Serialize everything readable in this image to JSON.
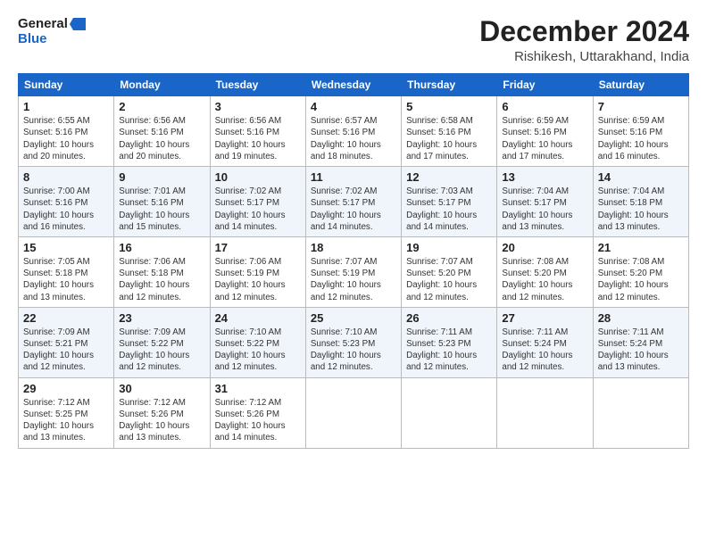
{
  "logo": {
    "line1": "General",
    "line2": "Blue"
  },
  "header": {
    "month": "December 2024",
    "location": "Rishikesh, Uttarakhand, India"
  },
  "weekdays": [
    "Sunday",
    "Monday",
    "Tuesday",
    "Wednesday",
    "Thursday",
    "Friday",
    "Saturday"
  ],
  "weeks": [
    [
      {
        "day": "1",
        "sunrise": "Sunrise: 6:55 AM",
        "sunset": "Sunset: 5:16 PM",
        "daylight": "Daylight: 10 hours and 20 minutes."
      },
      {
        "day": "2",
        "sunrise": "Sunrise: 6:56 AM",
        "sunset": "Sunset: 5:16 PM",
        "daylight": "Daylight: 10 hours and 20 minutes."
      },
      {
        "day": "3",
        "sunrise": "Sunrise: 6:56 AM",
        "sunset": "Sunset: 5:16 PM",
        "daylight": "Daylight: 10 hours and 19 minutes."
      },
      {
        "day": "4",
        "sunrise": "Sunrise: 6:57 AM",
        "sunset": "Sunset: 5:16 PM",
        "daylight": "Daylight: 10 hours and 18 minutes."
      },
      {
        "day": "5",
        "sunrise": "Sunrise: 6:58 AM",
        "sunset": "Sunset: 5:16 PM",
        "daylight": "Daylight: 10 hours and 17 minutes."
      },
      {
        "day": "6",
        "sunrise": "Sunrise: 6:59 AM",
        "sunset": "Sunset: 5:16 PM",
        "daylight": "Daylight: 10 hours and 17 minutes."
      },
      {
        "day": "7",
        "sunrise": "Sunrise: 6:59 AM",
        "sunset": "Sunset: 5:16 PM",
        "daylight": "Daylight: 10 hours and 16 minutes."
      }
    ],
    [
      {
        "day": "8",
        "sunrise": "Sunrise: 7:00 AM",
        "sunset": "Sunset: 5:16 PM",
        "daylight": "Daylight: 10 hours and 16 minutes."
      },
      {
        "day": "9",
        "sunrise": "Sunrise: 7:01 AM",
        "sunset": "Sunset: 5:16 PM",
        "daylight": "Daylight: 10 hours and 15 minutes."
      },
      {
        "day": "10",
        "sunrise": "Sunrise: 7:02 AM",
        "sunset": "Sunset: 5:17 PM",
        "daylight": "Daylight: 10 hours and 14 minutes."
      },
      {
        "day": "11",
        "sunrise": "Sunrise: 7:02 AM",
        "sunset": "Sunset: 5:17 PM",
        "daylight": "Daylight: 10 hours and 14 minutes."
      },
      {
        "day": "12",
        "sunrise": "Sunrise: 7:03 AM",
        "sunset": "Sunset: 5:17 PM",
        "daylight": "Daylight: 10 hours and 14 minutes."
      },
      {
        "day": "13",
        "sunrise": "Sunrise: 7:04 AM",
        "sunset": "Sunset: 5:17 PM",
        "daylight": "Daylight: 10 hours and 13 minutes."
      },
      {
        "day": "14",
        "sunrise": "Sunrise: 7:04 AM",
        "sunset": "Sunset: 5:18 PM",
        "daylight": "Daylight: 10 hours and 13 minutes."
      }
    ],
    [
      {
        "day": "15",
        "sunrise": "Sunrise: 7:05 AM",
        "sunset": "Sunset: 5:18 PM",
        "daylight": "Daylight: 10 hours and 13 minutes."
      },
      {
        "day": "16",
        "sunrise": "Sunrise: 7:06 AM",
        "sunset": "Sunset: 5:18 PM",
        "daylight": "Daylight: 10 hours and 12 minutes."
      },
      {
        "day": "17",
        "sunrise": "Sunrise: 7:06 AM",
        "sunset": "Sunset: 5:19 PM",
        "daylight": "Daylight: 10 hours and 12 minutes."
      },
      {
        "day": "18",
        "sunrise": "Sunrise: 7:07 AM",
        "sunset": "Sunset: 5:19 PM",
        "daylight": "Daylight: 10 hours and 12 minutes."
      },
      {
        "day": "19",
        "sunrise": "Sunrise: 7:07 AM",
        "sunset": "Sunset: 5:20 PM",
        "daylight": "Daylight: 10 hours and 12 minutes."
      },
      {
        "day": "20",
        "sunrise": "Sunrise: 7:08 AM",
        "sunset": "Sunset: 5:20 PM",
        "daylight": "Daylight: 10 hours and 12 minutes."
      },
      {
        "day": "21",
        "sunrise": "Sunrise: 7:08 AM",
        "sunset": "Sunset: 5:20 PM",
        "daylight": "Daylight: 10 hours and 12 minutes."
      }
    ],
    [
      {
        "day": "22",
        "sunrise": "Sunrise: 7:09 AM",
        "sunset": "Sunset: 5:21 PM",
        "daylight": "Daylight: 10 hours and 12 minutes."
      },
      {
        "day": "23",
        "sunrise": "Sunrise: 7:09 AM",
        "sunset": "Sunset: 5:22 PM",
        "daylight": "Daylight: 10 hours and 12 minutes."
      },
      {
        "day": "24",
        "sunrise": "Sunrise: 7:10 AM",
        "sunset": "Sunset: 5:22 PM",
        "daylight": "Daylight: 10 hours and 12 minutes."
      },
      {
        "day": "25",
        "sunrise": "Sunrise: 7:10 AM",
        "sunset": "Sunset: 5:23 PM",
        "daylight": "Daylight: 10 hours and 12 minutes."
      },
      {
        "day": "26",
        "sunrise": "Sunrise: 7:11 AM",
        "sunset": "Sunset: 5:23 PM",
        "daylight": "Daylight: 10 hours and 12 minutes."
      },
      {
        "day": "27",
        "sunrise": "Sunrise: 7:11 AM",
        "sunset": "Sunset: 5:24 PM",
        "daylight": "Daylight: 10 hours and 12 minutes."
      },
      {
        "day": "28",
        "sunrise": "Sunrise: 7:11 AM",
        "sunset": "Sunset: 5:24 PM",
        "daylight": "Daylight: 10 hours and 13 minutes."
      }
    ],
    [
      {
        "day": "29",
        "sunrise": "Sunrise: 7:12 AM",
        "sunset": "Sunset: 5:25 PM",
        "daylight": "Daylight: 10 hours and 13 minutes."
      },
      {
        "day": "30",
        "sunrise": "Sunrise: 7:12 AM",
        "sunset": "Sunset: 5:26 PM",
        "daylight": "Daylight: 10 hours and 13 minutes."
      },
      {
        "day": "31",
        "sunrise": "Sunrise: 7:12 AM",
        "sunset": "Sunset: 5:26 PM",
        "daylight": "Daylight: 10 hours and 14 minutes."
      },
      null,
      null,
      null,
      null
    ]
  ]
}
